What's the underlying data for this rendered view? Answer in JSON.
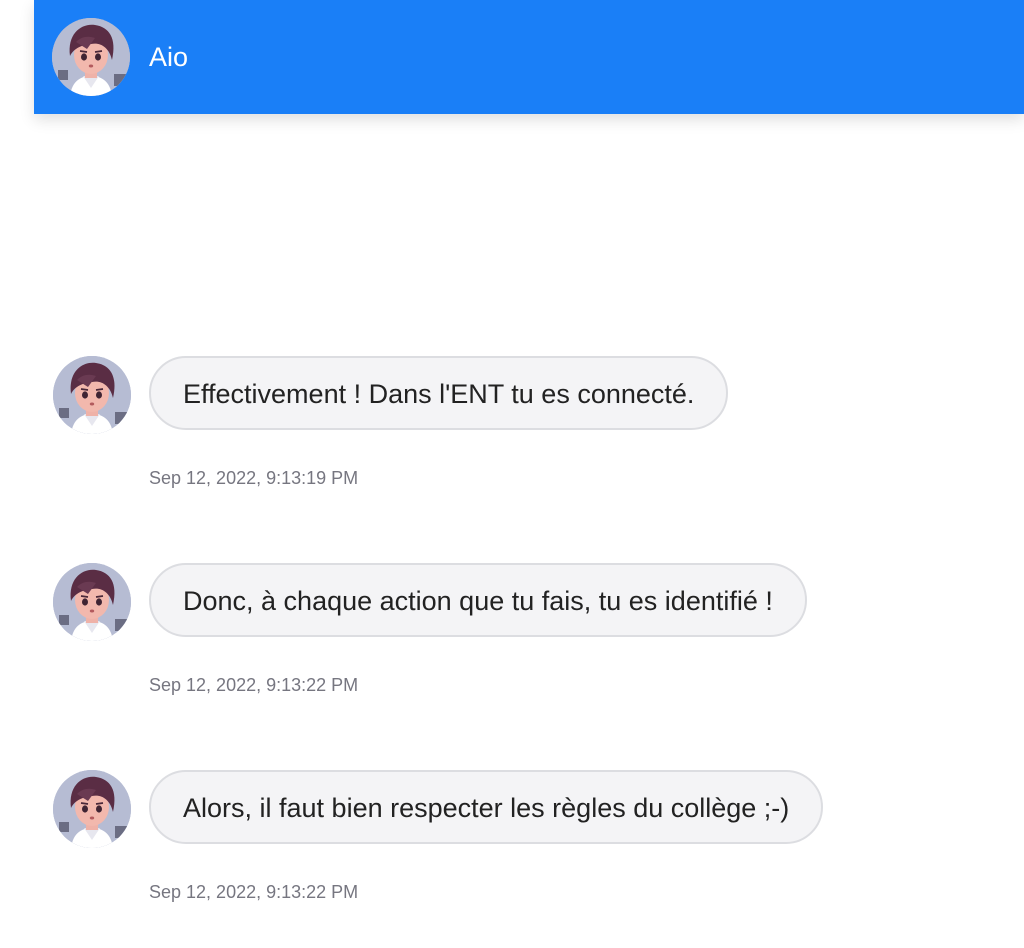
{
  "header": {
    "name": "Aio",
    "background": "#1a7ff7",
    "avatar_icon": "character-avatar-icon"
  },
  "messages": [
    {
      "text": "Effectivement ! Dans l'ENT tu es connecté.",
      "timestamp": "Sep 12, 2022, 9:13:19 PM"
    },
    {
      "text": "Donc, à chaque action que tu fais, tu es identifié !",
      "timestamp": "Sep 12, 2022, 9:13:22 PM"
    },
    {
      "text": "Alors, il faut bien respecter les règles du collège ;-)",
      "timestamp": "Sep 12, 2022, 9:13:22 PM"
    }
  ],
  "colors": {
    "bubble_background": "#f4f4f6",
    "bubble_border": "#dcdde1",
    "timestamp": "#767680",
    "text": "#222222"
  }
}
